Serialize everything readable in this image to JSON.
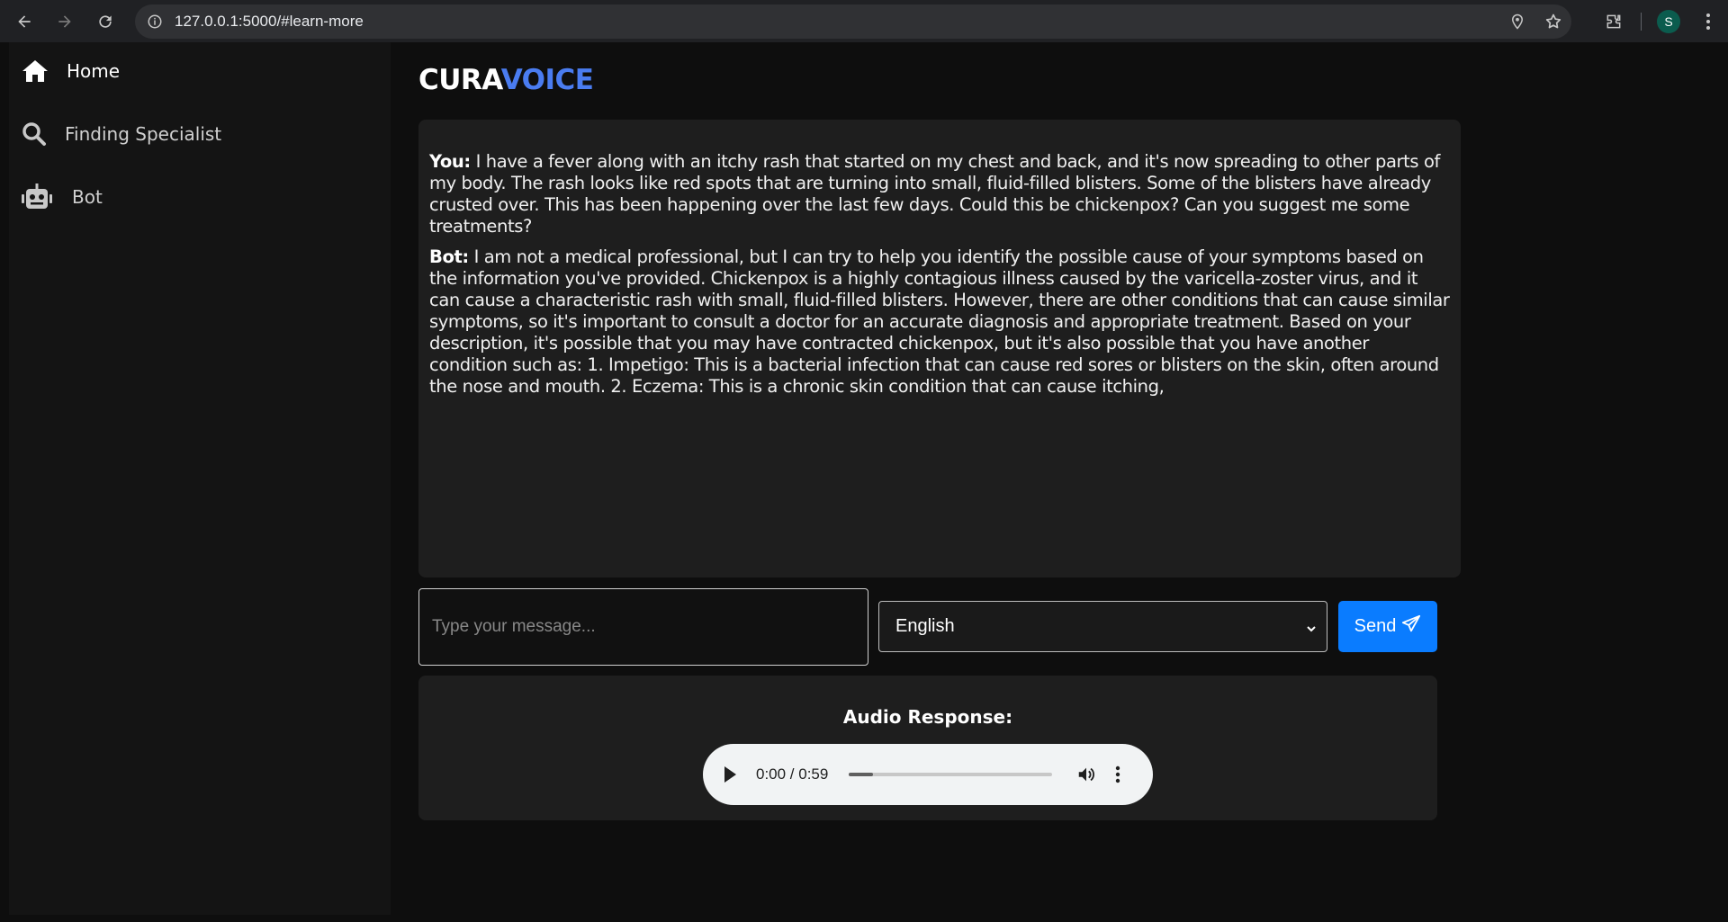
{
  "browser": {
    "url": "127.0.0.1:5000/#learn-more",
    "profile_initial": "S"
  },
  "sidebar": {
    "items": [
      {
        "label": "Home",
        "icon": "home-icon"
      },
      {
        "label": "Finding Specialist",
        "icon": "search-icon"
      },
      {
        "label": "Bot",
        "icon": "robot-icon"
      }
    ]
  },
  "brand": {
    "part1": "CURA",
    "part2": "VOICE",
    "accent_color": "#4a7cf0"
  },
  "chat": {
    "messages": [
      {
        "speaker": "You:",
        "text": "I have a fever along with an itchy rash that started on my chest and back, and it's now spreading to other parts of my body. The rash looks like red spots that are turning into small, fluid-filled blisters. Some of the blisters have already crusted over. This has been happening over the last few days. Could this be chickenpox? Can you suggest me some treatments?"
      },
      {
        "speaker": "Bot:",
        "text": "I am not a medical professional, but I can try to help you identify the possible cause of your symptoms based on the information you've provided. Chickenpox is a highly contagious illness caused by the varicella-zoster virus, and it can cause a characteristic rash with small, fluid-filled blisters. However, there are other conditions that can cause similar symptoms, so it's important to consult a doctor for an accurate diagnosis and appropriate treatment. Based on your description, it's possible that you may have contracted chickenpox, but it's also possible that you have another condition such as: 1. Impetigo: This is a bacterial infection that can cause red sores or blisters on the skin, often around the nose and mouth. 2. Eczema: This is a chronic skin condition that can cause itching,"
      }
    ]
  },
  "composer": {
    "placeholder": "Type your message...",
    "language": "English",
    "send_label": "Send",
    "send_color": "#0a7cff"
  },
  "audio": {
    "title": "Audio Response:",
    "time": "0:00 / 0:59",
    "progress": 0.12
  }
}
